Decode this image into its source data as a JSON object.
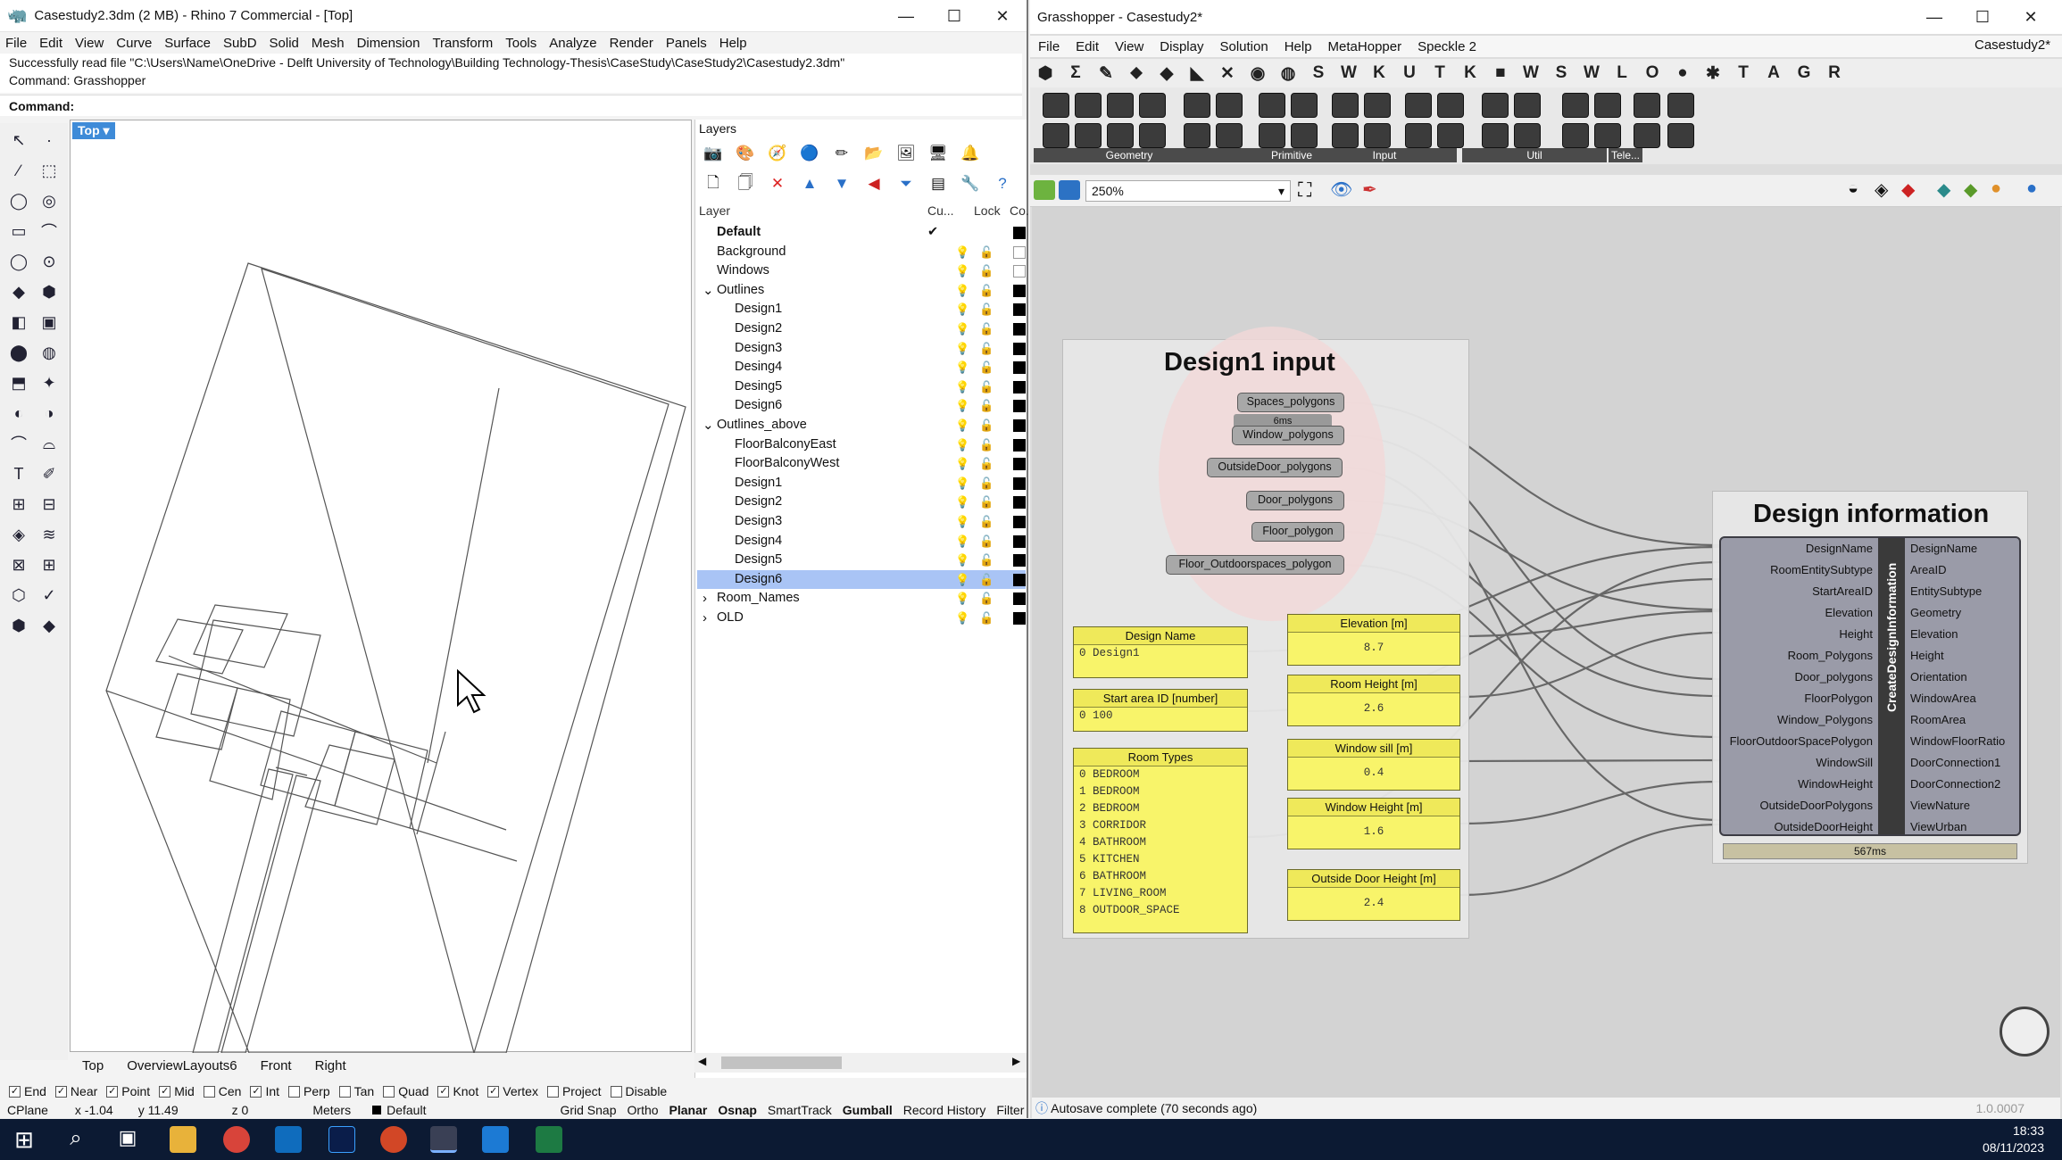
{
  "rhino": {
    "title": "Casestudy2.3dm (2 MB) - Rhino 7 Commercial - [Top]",
    "menu": [
      "File",
      "Edit",
      "View",
      "Curve",
      "Surface",
      "SubD",
      "Solid",
      "Mesh",
      "Dimension",
      "Transform",
      "Tools",
      "Analyze",
      "Render",
      "Panels",
      "Help"
    ],
    "history_line1": "Successfully read file \"C:\\Users\\Name\\OneDrive - Delft University of Technology\\Building Technology-Thesis\\CaseStudy\\CaseStudy2\\Casestudy2.3dm\"",
    "history_line2": "Command: Grasshopper",
    "command_label": "Command:",
    "viewport_label": "Top",
    "viewport_tabs": [
      "Top",
      "OverviewLayouts6",
      "Front",
      "Right"
    ],
    "layers_title": "Layers",
    "layer_cols": {
      "layer": "Layer",
      "current": "Cu...",
      "lock": "Lock",
      "color": "Co..."
    },
    "layers": [
      {
        "name": "Default",
        "indent": 0,
        "bold": true,
        "current": true
      },
      {
        "name": "Background",
        "indent": 0
      },
      {
        "name": "Windows",
        "indent": 0
      },
      {
        "name": "Outlines",
        "indent": 0,
        "expander": "v"
      },
      {
        "name": "Design1",
        "indent": 1
      },
      {
        "name": "Design2",
        "indent": 1
      },
      {
        "name": "Design3",
        "indent": 1
      },
      {
        "name": "Desing4",
        "indent": 1
      },
      {
        "name": "Desing5",
        "indent": 1
      },
      {
        "name": "Design6",
        "indent": 1
      },
      {
        "name": "Outlines_above",
        "indent": 0,
        "expander": "v"
      },
      {
        "name": "FloorBalconyEast",
        "indent": 1
      },
      {
        "name": "FloorBalconyWest",
        "indent": 1
      },
      {
        "name": "Design1",
        "indent": 1
      },
      {
        "name": "Design2",
        "indent": 1
      },
      {
        "name": "Design3",
        "indent": 1
      },
      {
        "name": "Design4",
        "indent": 1
      },
      {
        "name": "Design5",
        "indent": 1
      },
      {
        "name": "Design6",
        "indent": 1,
        "selected": true
      },
      {
        "name": "Room_Names",
        "indent": 0,
        "expander": ">"
      },
      {
        "name": "OLD",
        "indent": 0,
        "expander": ">"
      }
    ],
    "osnaps": [
      {
        "label": "End",
        "on": true
      },
      {
        "label": "Near",
        "on": true
      },
      {
        "label": "Point",
        "on": true
      },
      {
        "label": "Mid",
        "on": true
      },
      {
        "label": "Cen",
        "on": false
      },
      {
        "label": "Int",
        "on": true
      },
      {
        "label": "Perp",
        "on": false
      },
      {
        "label": "Tan",
        "on": false
      },
      {
        "label": "Quad",
        "on": false
      },
      {
        "label": "Knot",
        "on": true
      },
      {
        "label": "Vertex",
        "on": true
      },
      {
        "label": "Project",
        "on": false
      },
      {
        "label": "Disable",
        "on": false
      }
    ],
    "status": {
      "cplane": "CPlane",
      "x": "x -1.04",
      "y": "y 11.49",
      "z": "z 0",
      "units": "Meters",
      "layer": "Default",
      "items": [
        "Grid Snap",
        "Ortho",
        "Planar",
        "Osnap",
        "SmartTrack",
        "Gumball",
        "Record History",
        "Filter"
      ]
    }
  },
  "grasshopper": {
    "title": "Grasshopper - Casestudy2*",
    "doc_name": "Casestudy2*",
    "menu": [
      "File",
      "Edit",
      "View",
      "Display",
      "Solution",
      "Help",
      "MetaHopper",
      "Speckle 2"
    ],
    "tab_letters": [
      "Σ",
      "✎",
      "⬥",
      "◆",
      "◣",
      "✕",
      "◉",
      "◍",
      "S",
      "W",
      "K",
      "U",
      "T",
      "K",
      "■",
      "W",
      "S",
      "W",
      "L",
      "O",
      "●",
      "✱",
      "T",
      "A",
      "G",
      "R"
    ],
    "ribbon_groups": [
      "Geometry",
      "Primitive",
      "Input",
      "Util",
      "Tele..."
    ],
    "zoom": "250%",
    "group_title": "Design1 input",
    "params": [
      "Spaces_polygons",
      "Window_polygons",
      "OutsideDoor_polygons",
      "Door_polygons",
      "Floor_polygon",
      "Floor_Outdoorspaces_polygon"
    ],
    "timing_small": "6ms",
    "design_name": {
      "title": "Design Name",
      "value": "0 Design1"
    },
    "start_area": {
      "title": "Start area ID [number]",
      "value": "0 100"
    },
    "room_types": {
      "title": "Room Types",
      "items": [
        "0 BEDROOM",
        "1 BEDROOM",
        "2 BEDROOM",
        "3 CORRIDOR",
        "4 BATHROOM",
        "5 KITCHEN",
        "6 BATHROOM",
        "7 LIVING_ROOM",
        "8 OUTDOOR_SPACE"
      ]
    },
    "sliders": [
      {
        "title": "Elevation [m]",
        "value": "8.7"
      },
      {
        "title": "Room Height [m]",
        "value": "2.6"
      },
      {
        "title": "Window sill [m]",
        "value": "0.4"
      },
      {
        "title": "Window Height [m]",
        "value": "1.6"
      },
      {
        "title": "Outside Door Height [m]",
        "value": "2.4"
      }
    ],
    "component": {
      "group_title": "Design information",
      "name": "CreateDesignInformation",
      "inputs": [
        "DesignName",
        "RoomEntitySubtype",
        "StartAreaID",
        "Elevation",
        "Height",
        "Room_Polygons",
        "Door_polygons",
        "FloorPolygon",
        "Window_Polygons",
        "FloorOutdoorSpacePolygon",
        "WindowSill",
        "WindowHeight",
        "OutsideDoorPolygons",
        "OutsideDoorHeight"
      ],
      "outputs": [
        "DesignName",
        "AreaID",
        "EntitySubtype",
        "Geometry",
        "Elevation",
        "Height",
        "Orientation",
        "WindowArea",
        "RoomArea",
        "WindowFloorRatio",
        "DoorConnection1",
        "DoorConnection2",
        "ViewNature",
        "ViewUrban"
      ],
      "timing": "567ms"
    },
    "autosave": "Autosave complete (70 seconds ago)",
    "version": "1.0.0007"
  },
  "taskbar": {
    "time": "18:33",
    "date": "08/11/2023"
  }
}
